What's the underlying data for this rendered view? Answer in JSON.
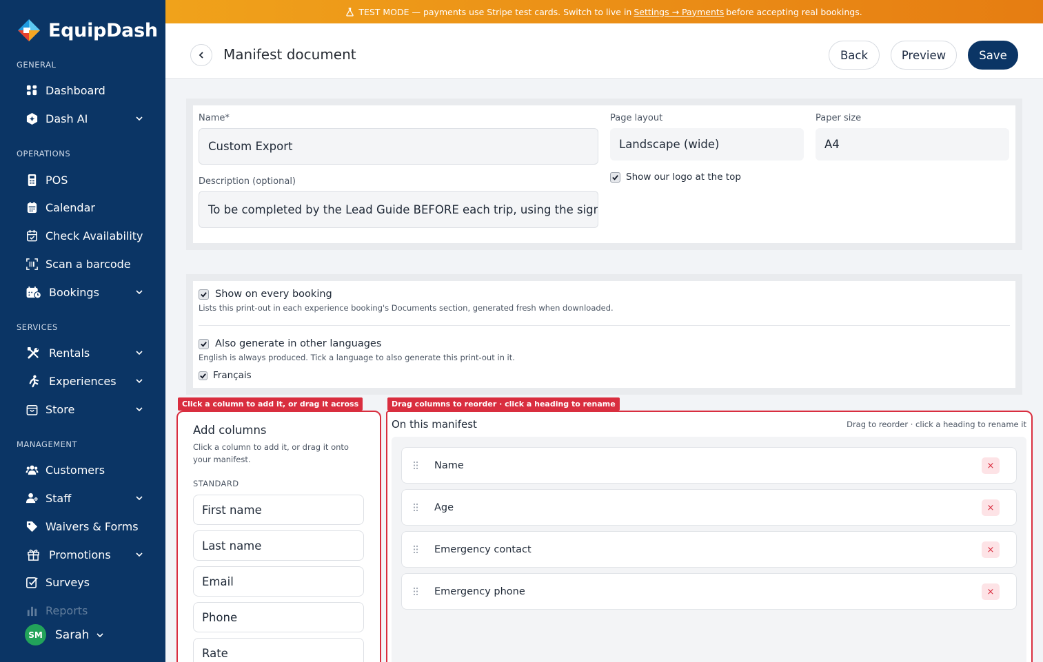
{
  "brand": {
    "name": "EquipDash"
  },
  "sidebar": {
    "sections": {
      "general": "GENERAL",
      "operations": "OPERATIONS",
      "services": "SERVICES",
      "management": "MANAGEMENT"
    },
    "items": [
      {
        "label": "Dashboard",
        "icon": "grid-icon"
      },
      {
        "label": "Dash AI",
        "icon": "hexagon-ai-icon"
      },
      {
        "label": "POS",
        "icon": "pos-terminal-icon"
      },
      {
        "label": "Calendar",
        "icon": "calendar-icon"
      },
      {
        "label": "Check Availability",
        "icon": "calendar-check-icon"
      },
      {
        "label": "Scan a barcode",
        "icon": "barcode-scan-icon"
      },
      {
        "label": "Bookings",
        "icon": "bookings-icon"
      },
      {
        "label": "Rentals",
        "icon": "tools-icon"
      },
      {
        "label": "Experiences",
        "icon": "person-activity-icon"
      },
      {
        "label": "Store",
        "icon": "store-bag-icon"
      },
      {
        "label": "Customers",
        "icon": "users-icon"
      },
      {
        "label": "Staff",
        "icon": "staff-icon"
      },
      {
        "label": "Waivers & Forms",
        "icon": "tag-icon"
      },
      {
        "label": "Promotions",
        "icon": "gift-icon"
      },
      {
        "label": "Surveys",
        "icon": "survey-check-icon"
      },
      {
        "label": "Reports",
        "icon": "bar-chart-icon"
      }
    ],
    "user": {
      "initials": "SM",
      "name": "Sarah"
    }
  },
  "banner": {
    "prefix": "TEST MODE — payments use Stripe test cards. Switch to live in",
    "link": "Settings → Payments",
    "suffix": "before accepting real bookings."
  },
  "header": {
    "title": "Manifest document",
    "back_label": "Back",
    "preview_label": "Preview",
    "save_label": "Save"
  },
  "form": {
    "name_label": "Name*",
    "name_value": "Custom Export",
    "description_label": "Description (optional)",
    "description_value": "To be completed by the Lead Guide BEFORE each trip, using the signed A",
    "page_layout_label": "Page layout",
    "page_layout_value": "Landscape (wide)",
    "paper_size_label": "Paper size",
    "paper_size_value": "A4",
    "show_logo_label": "Show our logo at the top"
  },
  "options": {
    "show_every_label": "Show on every booking",
    "show_every_help": "Lists this print-out in each experience booking's Documents section, generated fresh when downloaded.",
    "languages_label": "Also generate in other languages",
    "languages_help": "English is always produced. Tick a language to also generate this print-out in it.",
    "french_label": "Français"
  },
  "add_columns": {
    "tag": "Click a column to add it, or drag it across",
    "title": "Add columns",
    "help_line1": "Click a column to add it, or drag it onto",
    "help_line2": "your manifest.",
    "group": "STANDARD",
    "items": [
      "First name",
      "Last name",
      "Email",
      "Phone",
      "Rate"
    ]
  },
  "manifest": {
    "tag": "Drag columns to reorder · click a heading to rename",
    "title": "On this manifest",
    "hint": "Drag to reorder · click a heading to rename it",
    "columns": [
      "Name",
      "Age",
      "Emergency contact",
      "Emergency phone"
    ],
    "remove_symbol": "×"
  },
  "colors": {
    "sidebar": "#0b3565",
    "banner": "#f0a21b",
    "accent_red": "#d92e3f",
    "avatar": "#22a35a"
  }
}
